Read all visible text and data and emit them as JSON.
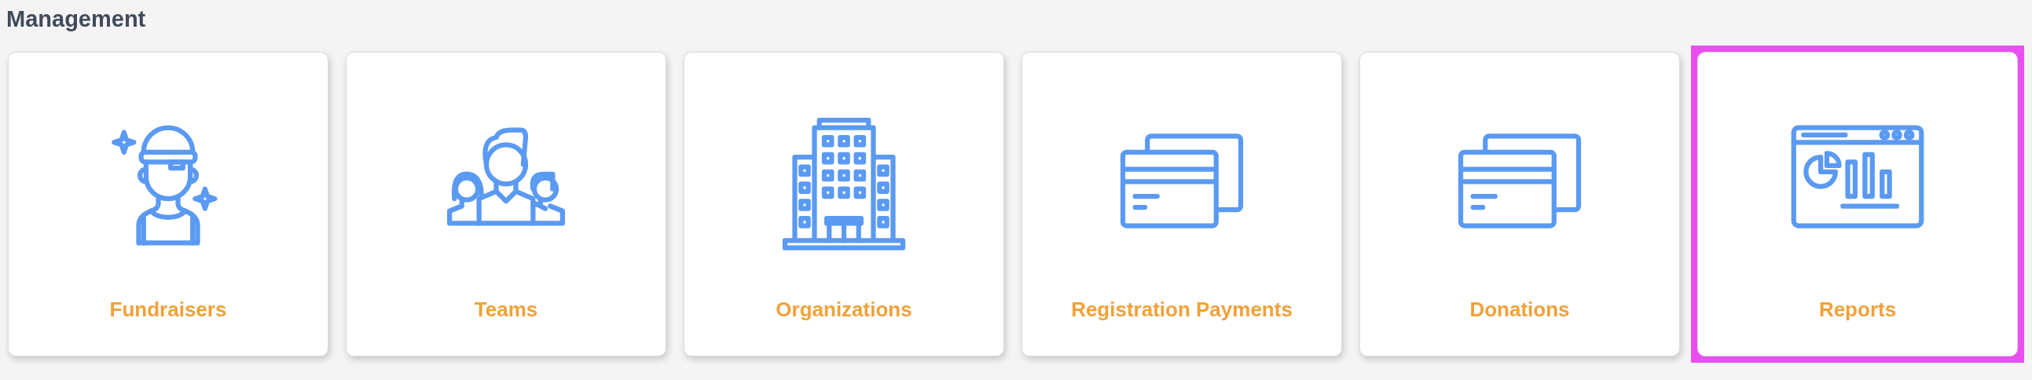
{
  "section": {
    "title": "Management"
  },
  "cards": [
    {
      "label": "Fundraisers",
      "kind": "fundraiser",
      "selected": false
    },
    {
      "label": "Teams",
      "kind": "team",
      "selected": false
    },
    {
      "label": "Organizations",
      "kind": "building",
      "selected": false
    },
    {
      "label": "Registration Payments",
      "kind": "cards",
      "selected": false
    },
    {
      "label": "Donations",
      "kind": "cards",
      "selected": false
    },
    {
      "label": "Reports",
      "kind": "report",
      "selected": true
    }
  ]
}
